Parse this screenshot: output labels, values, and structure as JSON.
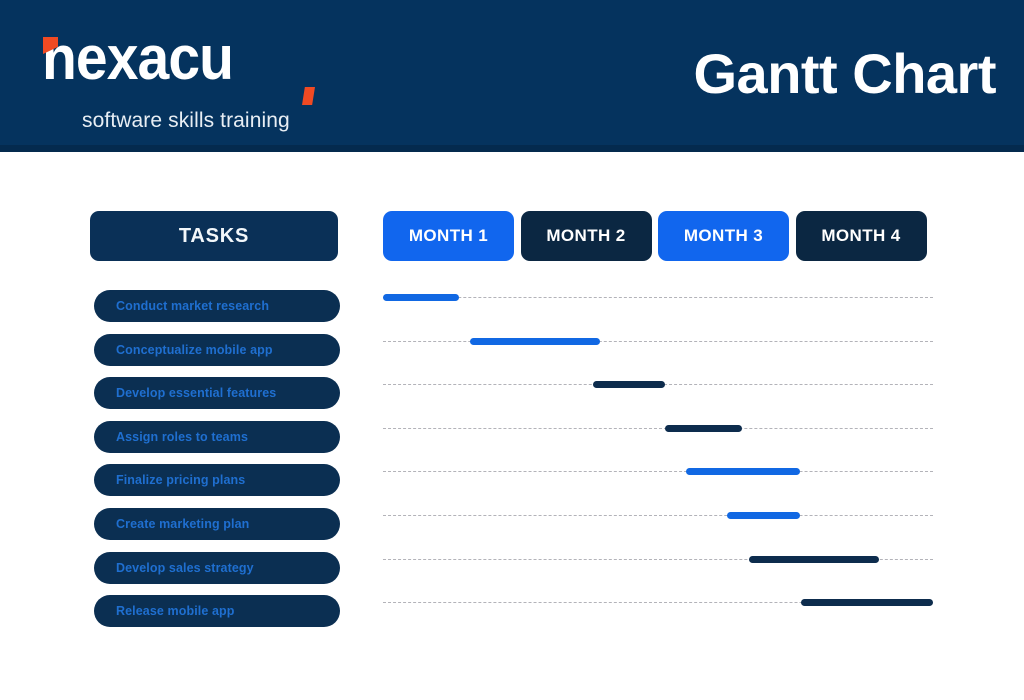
{
  "header": {
    "logo": {
      "wordmark": "nexacu",
      "tagline": "software skills training",
      "accent_color": "#f04a23"
    },
    "title": "Gantt Chart",
    "background_color": "#05335e"
  },
  "tasks_column": {
    "header_label": "TASKS",
    "items": [
      "Conduct market research",
      "Conceptualize mobile app",
      "Develop essential features",
      "Assign roles to teams",
      "Finalize pricing plans",
      "Create marketing plan",
      "Develop sales strategy",
      "Release mobile app"
    ]
  },
  "timeline": {
    "months": [
      {
        "label": "MONTH 1",
        "color": "#1166ee"
      },
      {
        "label": "MONTH 2",
        "color": "#0b2742"
      },
      {
        "label": "MONTH 3",
        "color": "#1166ee"
      },
      {
        "label": "MONTH 4",
        "color": "#0b2742"
      }
    ]
  },
  "chart_data": {
    "type": "bar",
    "title": "Gantt Chart",
    "xlabel": "",
    "ylabel": "",
    "orientation": "horizontal",
    "axis_unit": "month",
    "xlim": [
      0,
      4
    ],
    "grid": true,
    "legend": null,
    "categories": [
      "Conduct market research",
      "Conceptualize mobile app",
      "Develop essential features",
      "Assign roles to teams",
      "Finalize pricing plans",
      "Create marketing plan",
      "Develop sales strategy",
      "Release mobile app"
    ],
    "colors": {
      "blue": "#1168e3",
      "navy": "#0d2c4d"
    },
    "bars": [
      {
        "task": "Conduct market research",
        "start_month": 0.0,
        "end_month": 0.55,
        "color": "#1168e3"
      },
      {
        "task": "Conceptualize mobile app",
        "start_month": 0.63,
        "end_month": 1.58,
        "color": "#1168e3"
      },
      {
        "task": "Develop essential features",
        "start_month": 1.53,
        "end_month": 2.05,
        "color": "#0d2c4d"
      },
      {
        "task": "Assign roles to teams",
        "start_month": 2.05,
        "end_month": 2.61,
        "color": "#0d2c4d"
      },
      {
        "task": "Finalize pricing plans",
        "start_month": 2.2,
        "end_month": 3.03,
        "color": "#1168e3"
      },
      {
        "task": "Create marketing plan",
        "start_month": 2.5,
        "end_month": 3.03,
        "color": "#1168e3"
      },
      {
        "task": "Develop sales strategy",
        "start_month": 2.66,
        "end_month": 3.61,
        "color": "#0d2c4d"
      },
      {
        "task": "Release mobile app",
        "start_month": 3.04,
        "end_month": 4.0,
        "color": "#0d2c4d"
      }
    ]
  }
}
